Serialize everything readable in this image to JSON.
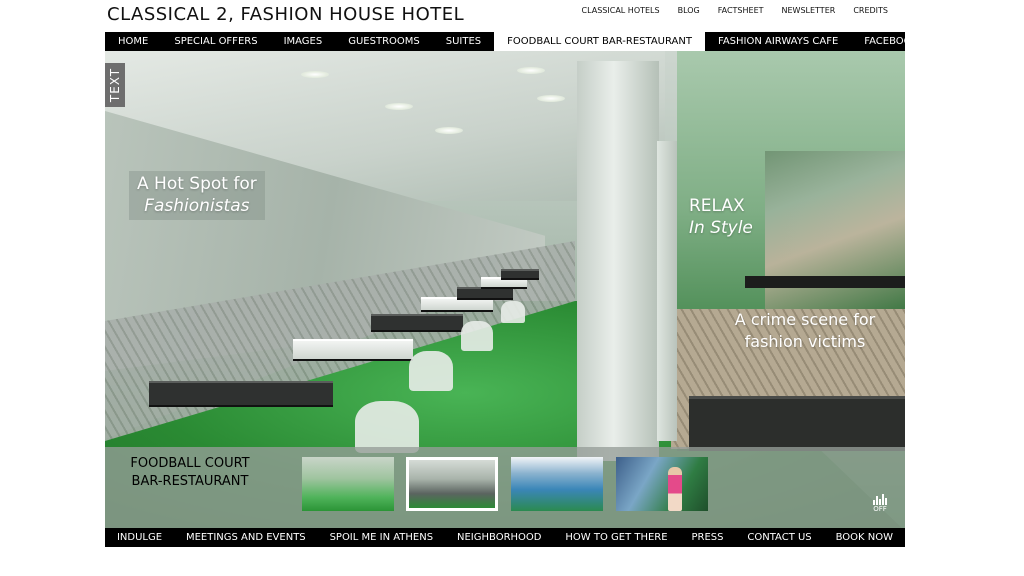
{
  "site": {
    "title": "CLASSICAL 2, FASHION HOUSE HOTEL"
  },
  "top_links": [
    "CLASSICAL HOTELS",
    "BLOG",
    "FACTSHEET",
    "NEWSLETTER",
    "CREDITS"
  ],
  "main_nav": {
    "items": [
      "HOME",
      "SPECIAL OFFERS",
      "IMAGES",
      "GUESTROOMS",
      "SUITES",
      "FOODBALL COURT BAR-RESTAURANT",
      "FASHION AIRWAYS CAFE",
      "FACEBOOK"
    ],
    "active": "FOODBALL COURT BAR-RESTAURANT"
  },
  "hero": {
    "text_tab": "TEXT",
    "captions": {
      "hotspot_line1": "A Hot Spot for",
      "hotspot_line2": "Fashionistas",
      "relax_line1": "RELAX",
      "relax_line2": "In Style",
      "crime_line1": "A crime scene for",
      "crime_line2": "fashion victims"
    }
  },
  "gallery": {
    "title_line1": "FOODBALL COURT",
    "title_line2": "BAR-RESTAURANT",
    "selected_index": 1,
    "sound_label": "OFF"
  },
  "footer_nav": [
    "INDULGE",
    "MEETINGS AND EVENTS",
    "SPOIL ME IN ATHENS",
    "NEIGHBORHOOD",
    "HOW TO GET THERE",
    "PRESS",
    "CONTACT US",
    "BOOK NOW"
  ],
  "colors": {
    "nav_bg": "#000000",
    "nav_active_bg": "#ffffff",
    "floor_green": "#2a8a33"
  }
}
